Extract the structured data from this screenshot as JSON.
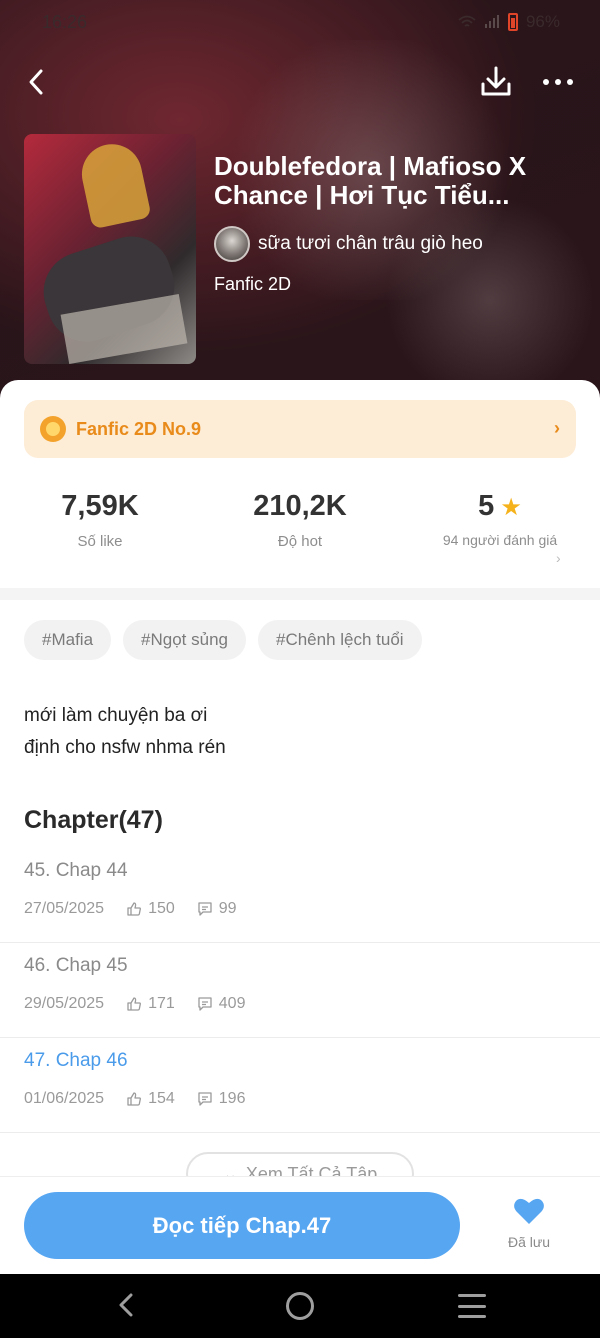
{
  "status_bar": {
    "time": "16:26",
    "battery": "96%"
  },
  "book": {
    "title": "Doublefedora | Mafioso X Chance | Hơi Tục Tiểu...",
    "author": "sữa tươi chân trâu giò heo",
    "genre": "Fanfic 2D"
  },
  "rank": {
    "label": "Fanfic 2D No.9"
  },
  "stats": {
    "likes_value": "7,59K",
    "likes_label": "Số like",
    "hot_value": "210,2K",
    "hot_label": "Độ hot",
    "rating_value": "5",
    "rating_label": "94 người đánh giá"
  },
  "tags": [
    "#Mafia",
    "#Ngọt sủng",
    "#Chênh lệch tuổi"
  ],
  "description": {
    "line1": "mới làm chuyện ba ơi",
    "line2": "định cho nsfw nhma rén"
  },
  "chapters": {
    "heading": "Chapter(47)",
    "items": [
      {
        "title": "45. Chap 44",
        "date": "27/05/2025",
        "likes": "150",
        "comments": "99"
      },
      {
        "title": "46. Chap 45",
        "date": "29/05/2025",
        "likes": "171",
        "comments": "409"
      },
      {
        "title": "47. Chap 46",
        "date": "01/06/2025",
        "likes": "154",
        "comments": "196"
      }
    ],
    "see_all": "Xem Tất Cả Tập"
  },
  "bottom": {
    "read_button": "Đọc tiếp Chap.47",
    "saved_label": "Đã lưu"
  },
  "colors": {
    "accent": "#56a6f2",
    "rank_text": "#e88b1b",
    "star": "#f6b21b"
  }
}
